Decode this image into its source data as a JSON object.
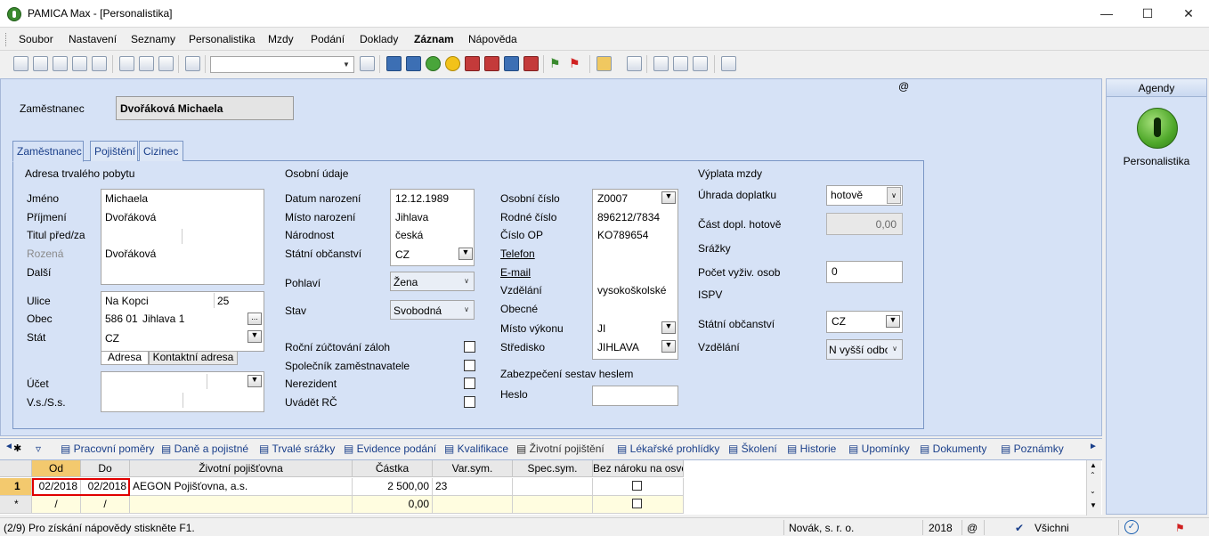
{
  "window": {
    "title": "PAMICA Max - [Personalistika]"
  },
  "menu": [
    "Soubor",
    "Nastavení",
    "Seznamy",
    "Personalistika",
    "Mzdy",
    "Podání",
    "Doklady",
    "Záznam",
    "Nápověda"
  ],
  "employee": {
    "label": "Zaměstnanec",
    "name": "Dvořáková Michaela"
  },
  "at_symbol": "@",
  "tabs": [
    "Zaměstnanec",
    "Pojištění",
    "Cizinec"
  ],
  "address": {
    "section": "Adresa trvalého pobytu",
    "labels": {
      "jmeno": "Jméno",
      "prijmeni": "Příjmení",
      "titul": "Titul před/za",
      "rozena": "Rozená",
      "dalsi": "Další",
      "ulice": "Ulice",
      "obec": "Obec",
      "stat": "Stát",
      "ucet": "Účet",
      "vss": "V.s./S.s."
    },
    "values": {
      "jmeno": "Michaela",
      "prijmeni": "Dvořáková",
      "rozena": "Dvořáková",
      "ulice": "Na Kopci",
      "cislo": "25",
      "psc": "586 01",
      "obec": "Jihlava 1",
      "stat": "CZ"
    },
    "subtabs": [
      "Adresa",
      "Kontaktní adresa"
    ]
  },
  "personal": {
    "section": "Osobní údaje",
    "labels": {
      "datum": "Datum narození",
      "misto": "Místo narození",
      "narodnost": "Národnost",
      "obcanstvi": "Státní občanství",
      "pohlavi": "Pohlaví",
      "stav": "Stav",
      "rocni": "Roční zúčtování záloh",
      "spolecnik": "Společník zaměstnavatele",
      "nerezident": "Nerezident",
      "uvadet": "Uvádět RČ"
    },
    "values": {
      "datum": "12.12.1989",
      "misto": "Jihlava",
      "narodnost": "česká",
      "obcanstvi": "CZ",
      "pohlavi": "Žena",
      "stav": "Svobodná"
    }
  },
  "ids": {
    "labels": {
      "osobni": "Osobní číslo",
      "rodne": "Rodné číslo",
      "op": "Číslo OP",
      "telefon": "Telefon",
      "email": "E-mail",
      "vzdelani": "Vzdělání",
      "obecne": "Obecné",
      "misto_vykonu": "Místo výkonu",
      "stredisko": "Středisko",
      "zabezpeceni": "Zabezpečení sestav heslem",
      "heslo": "Heslo"
    },
    "values": {
      "osobni": "Z0007",
      "rodne": "896212/7834",
      "op": "KO789654",
      "vzdelani": "vysokoškolské",
      "misto_vykonu": "JI",
      "stredisko": "JIHLAVA"
    }
  },
  "pay": {
    "section": "Výplata mzdy",
    "labels": {
      "uhrada": "Úhrada doplatku",
      "cast": "Část dopl. hotově",
      "srazky": "Srážky",
      "pocet": "Počet vyživ. osob",
      "ispv": "ISPV",
      "obcanstvi": "Státní občanství",
      "vzdelani": "Vzdělání"
    },
    "values": {
      "uhrada": "hotově",
      "cast": "0,00",
      "pocet": "0",
      "obcanstvi": "CZ",
      "vzdelani": "N vyšší odbo"
    }
  },
  "bottom_tabs": [
    "Pracovní poměry",
    "Daně a pojistné",
    "Trvalé srážky",
    "Evidence podání",
    "Kvalifikace",
    "Životní pojištění",
    "Lékařské prohlídky",
    "Školení",
    "Historie",
    "Upomínky",
    "Dokumenty",
    "Poznámky"
  ],
  "grid": {
    "columns": [
      "Od",
      "Do",
      "Životní pojišťovna",
      "Částka",
      "Var.sym.",
      "Spec.sym.",
      "Bez nároku na osvo"
    ],
    "rows": [
      {
        "num": "1",
        "od": "02/2018",
        "do": "02/2018",
        "pojistovna": "AEGON Pojišťovna, a.s.",
        "castka": "2 500,00",
        "var": "23",
        "spec": ""
      },
      {
        "num": "*",
        "od": "/",
        "do": "/",
        "pojistovna": "",
        "castka": "0,00",
        "var": "",
        "spec": ""
      }
    ]
  },
  "agenda": {
    "header": "Agendy",
    "item": "Personalistika"
  },
  "status": {
    "left": "(2/9) Pro získání nápovědy stiskněte F1.",
    "company": "Novák, s. r. o.",
    "year": "2018",
    "at": "@",
    "filter": "Všichni"
  }
}
